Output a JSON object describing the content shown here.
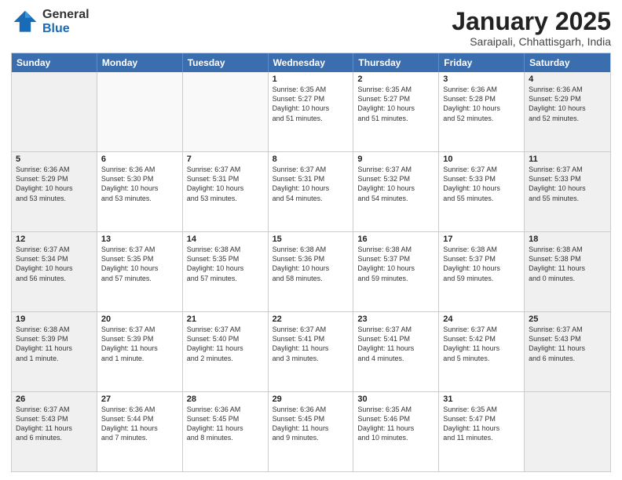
{
  "header": {
    "logo": {
      "general": "General",
      "blue": "Blue"
    },
    "title": "January 2025",
    "location": "Saraipali, Chhattisgarh, India"
  },
  "days_of_week": [
    "Sunday",
    "Monday",
    "Tuesday",
    "Wednesday",
    "Thursday",
    "Friday",
    "Saturday"
  ],
  "weeks": [
    [
      {
        "day": "",
        "info": "",
        "empty": true
      },
      {
        "day": "",
        "info": "",
        "empty": true
      },
      {
        "day": "",
        "info": "",
        "empty": true
      },
      {
        "day": "1",
        "info": "Sunrise: 6:35 AM\nSunset: 5:27 PM\nDaylight: 10 hours\nand 51 minutes."
      },
      {
        "day": "2",
        "info": "Sunrise: 6:35 AM\nSunset: 5:27 PM\nDaylight: 10 hours\nand 51 minutes."
      },
      {
        "day": "3",
        "info": "Sunrise: 6:36 AM\nSunset: 5:28 PM\nDaylight: 10 hours\nand 52 minutes."
      },
      {
        "day": "4",
        "info": "Sunrise: 6:36 AM\nSunset: 5:29 PM\nDaylight: 10 hours\nand 52 minutes."
      }
    ],
    [
      {
        "day": "5",
        "info": "Sunrise: 6:36 AM\nSunset: 5:29 PM\nDaylight: 10 hours\nand 53 minutes."
      },
      {
        "day": "6",
        "info": "Sunrise: 6:36 AM\nSunset: 5:30 PM\nDaylight: 10 hours\nand 53 minutes."
      },
      {
        "day": "7",
        "info": "Sunrise: 6:37 AM\nSunset: 5:31 PM\nDaylight: 10 hours\nand 53 minutes."
      },
      {
        "day": "8",
        "info": "Sunrise: 6:37 AM\nSunset: 5:31 PM\nDaylight: 10 hours\nand 54 minutes."
      },
      {
        "day": "9",
        "info": "Sunrise: 6:37 AM\nSunset: 5:32 PM\nDaylight: 10 hours\nand 54 minutes."
      },
      {
        "day": "10",
        "info": "Sunrise: 6:37 AM\nSunset: 5:33 PM\nDaylight: 10 hours\nand 55 minutes."
      },
      {
        "day": "11",
        "info": "Sunrise: 6:37 AM\nSunset: 5:33 PM\nDaylight: 10 hours\nand 55 minutes."
      }
    ],
    [
      {
        "day": "12",
        "info": "Sunrise: 6:37 AM\nSunset: 5:34 PM\nDaylight: 10 hours\nand 56 minutes."
      },
      {
        "day": "13",
        "info": "Sunrise: 6:37 AM\nSunset: 5:35 PM\nDaylight: 10 hours\nand 57 minutes."
      },
      {
        "day": "14",
        "info": "Sunrise: 6:38 AM\nSunset: 5:35 PM\nDaylight: 10 hours\nand 57 minutes."
      },
      {
        "day": "15",
        "info": "Sunrise: 6:38 AM\nSunset: 5:36 PM\nDaylight: 10 hours\nand 58 minutes."
      },
      {
        "day": "16",
        "info": "Sunrise: 6:38 AM\nSunset: 5:37 PM\nDaylight: 10 hours\nand 59 minutes."
      },
      {
        "day": "17",
        "info": "Sunrise: 6:38 AM\nSunset: 5:37 PM\nDaylight: 10 hours\nand 59 minutes."
      },
      {
        "day": "18",
        "info": "Sunrise: 6:38 AM\nSunset: 5:38 PM\nDaylight: 11 hours\nand 0 minutes."
      }
    ],
    [
      {
        "day": "19",
        "info": "Sunrise: 6:38 AM\nSunset: 5:39 PM\nDaylight: 11 hours\nand 1 minute."
      },
      {
        "day": "20",
        "info": "Sunrise: 6:37 AM\nSunset: 5:39 PM\nDaylight: 11 hours\nand 1 minute."
      },
      {
        "day": "21",
        "info": "Sunrise: 6:37 AM\nSunset: 5:40 PM\nDaylight: 11 hours\nand 2 minutes."
      },
      {
        "day": "22",
        "info": "Sunrise: 6:37 AM\nSunset: 5:41 PM\nDaylight: 11 hours\nand 3 minutes."
      },
      {
        "day": "23",
        "info": "Sunrise: 6:37 AM\nSunset: 5:41 PM\nDaylight: 11 hours\nand 4 minutes."
      },
      {
        "day": "24",
        "info": "Sunrise: 6:37 AM\nSunset: 5:42 PM\nDaylight: 11 hours\nand 5 minutes."
      },
      {
        "day": "25",
        "info": "Sunrise: 6:37 AM\nSunset: 5:43 PM\nDaylight: 11 hours\nand 6 minutes."
      }
    ],
    [
      {
        "day": "26",
        "info": "Sunrise: 6:37 AM\nSunset: 5:43 PM\nDaylight: 11 hours\nand 6 minutes."
      },
      {
        "day": "27",
        "info": "Sunrise: 6:36 AM\nSunset: 5:44 PM\nDaylight: 11 hours\nand 7 minutes."
      },
      {
        "day": "28",
        "info": "Sunrise: 6:36 AM\nSunset: 5:45 PM\nDaylight: 11 hours\nand 8 minutes."
      },
      {
        "day": "29",
        "info": "Sunrise: 6:36 AM\nSunset: 5:45 PM\nDaylight: 11 hours\nand 9 minutes."
      },
      {
        "day": "30",
        "info": "Sunrise: 6:35 AM\nSunset: 5:46 PM\nDaylight: 11 hours\nand 10 minutes."
      },
      {
        "day": "31",
        "info": "Sunrise: 6:35 AM\nSunset: 5:47 PM\nDaylight: 11 hours\nand 11 minutes."
      },
      {
        "day": "",
        "info": "",
        "empty": true
      }
    ]
  ]
}
